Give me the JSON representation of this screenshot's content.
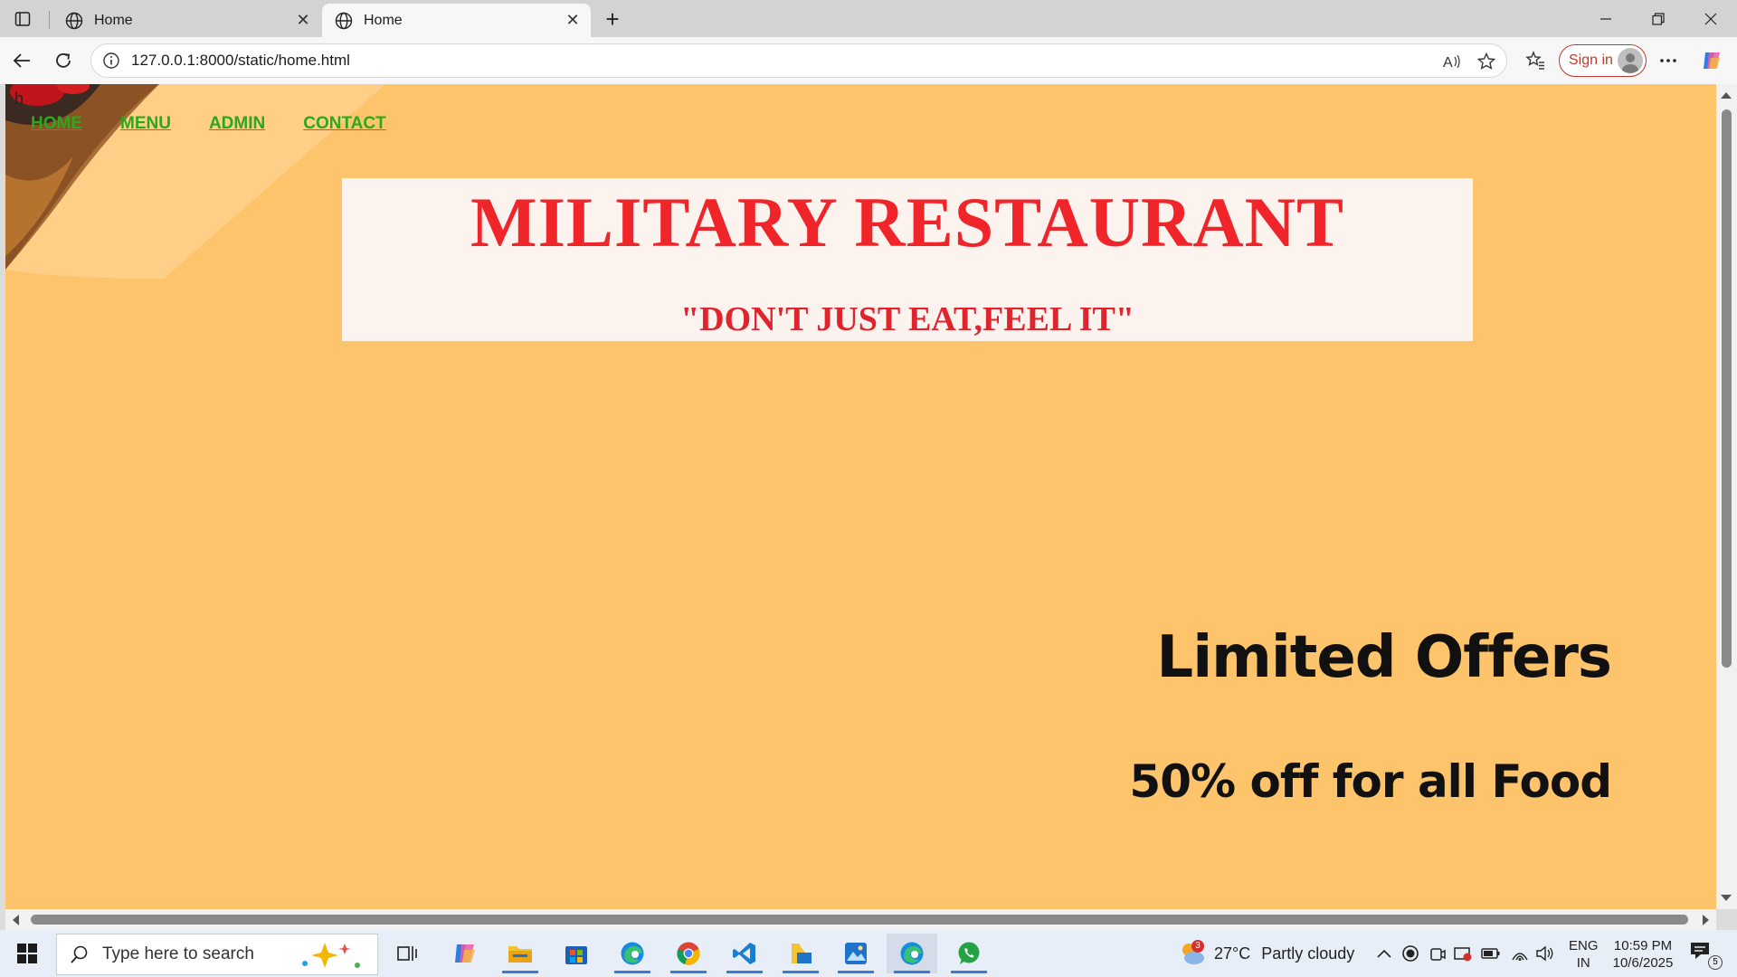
{
  "browser": {
    "tabs": [
      {
        "title": "Home",
        "active": false
      },
      {
        "title": "Home",
        "active": true
      }
    ],
    "address_bar": {
      "url": "127.0.0.1:8000/static/home.html"
    },
    "signin_label": "Sign in"
  },
  "page": {
    "stray_text": "h",
    "nav": [
      {
        "label": "HOME"
      },
      {
        "label": "MENU"
      },
      {
        "label": "ADMIN"
      },
      {
        "label": "CONTACT"
      }
    ],
    "hero": {
      "title": "MILITARY RESTAURANT",
      "tagline": "\"DON'T JUST EAT,FEEL IT\""
    },
    "offers": {
      "heading": "Limited Offers",
      "subheading": "50% off for all Food"
    },
    "colors": {
      "background": "#fec46b",
      "nav_link": "#2ba81b",
      "hero_text": "#f0252a",
      "hero_box": "#fcf2ee"
    }
  },
  "taskbar": {
    "search_placeholder": "Type here to search",
    "weather": {
      "temperature": "27°C",
      "condition": "Partly cloudy",
      "badge": "3"
    },
    "language": {
      "line1": "ENG",
      "line2": "IN"
    },
    "clock": {
      "time": "10:59 PM",
      "date": "10/6/2025"
    },
    "notification_count": "5",
    "apps": [
      "copilot-icon",
      "file-explorer-icon",
      "microsoft-store-icon",
      "edge-icon",
      "chrome-icon",
      "vscode-icon",
      "files-icon",
      "photos-icon",
      "edge-icon",
      "whatsapp-icon"
    ]
  }
}
